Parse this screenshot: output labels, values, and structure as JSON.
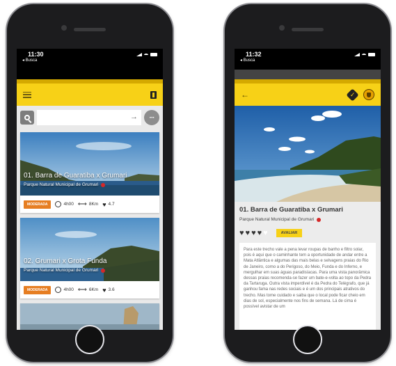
{
  "status": {
    "time_left": "11:30",
    "time_right": "11:32",
    "back_label": "◂ Busca"
  },
  "search": {
    "placeholder": "",
    "value": ""
  },
  "routes": [
    {
      "title": "01. Barra de Guaratiba x Grumari",
      "park": "Parque Natural Municipal de Grumari",
      "difficulty": "MODERADA",
      "duration": "4h00",
      "distance": "8Km",
      "rating": "4.7"
    },
    {
      "title": "02. Grumari x Grota Funda",
      "park": "Parque Natural Municipal de Grumari",
      "difficulty": "MODERADA",
      "duration": "4h00",
      "distance": "6Km",
      "rating": "3.6"
    }
  ],
  "detail": {
    "title": "01. Barra de Guaratiba x Grumari",
    "park": "Parque Natural Municipal de Grumari",
    "rate_button": "AVALIAR",
    "rating_hearts": 4,
    "rating_max": 5,
    "description": "Para este trecho vale a pena levar roupas de banho e filtro solar, pois é aqui que o caminhante tem a oportunidade de andar entre a Mata Atlântica e algumas das mais belas e selvagens praias do Rio de Janeiro, como a do Perigoso, do Meio, Funda e do Inferno, e mergulhar em suas águas paradisíacas. Para uma vista panorâmica dessas praias recomenda-se fazer um bate-e-volta ao topo da Pedra da Tartaruga. Outra vista imperdível é da Pedra do Telégrafo, que já ganhou fama nas redes sociais e é um dos principais atrativos do trecho. Mas tome cuidado e saiba que o local pode ficar cheio em dias de sol, especialmente nos fins de semana. Lá de cima é possível avistar de um"
  },
  "colors": {
    "accent": "#f7d117",
    "badge": "#e67e22",
    "park_dot": "#d62828"
  }
}
